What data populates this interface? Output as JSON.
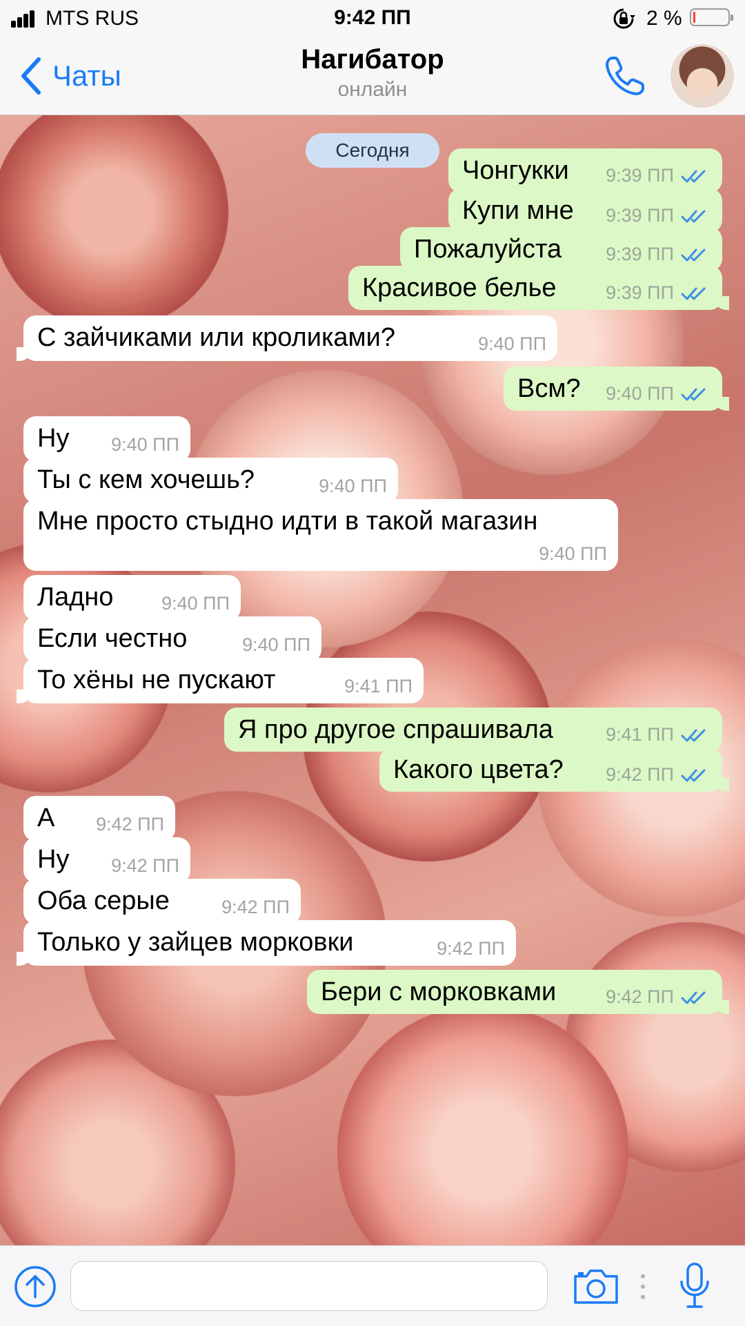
{
  "status_bar": {
    "carrier": "MTS RUS",
    "time": "9:42 ПП",
    "battery_percent": "2 %",
    "icons": [
      "signal-icon",
      "lock-rotation-icon",
      "battery-low-icon"
    ],
    "battery_level": 0.02
  },
  "header": {
    "back_label": "Чаты",
    "title": "Нагибатор",
    "subtitle": "онлайн",
    "icons": [
      "chevron-left-icon",
      "phone-icon",
      "avatar"
    ]
  },
  "date_separator": "Сегодня",
  "messages": [
    {
      "dir": "out",
      "text": "Чонгукки",
      "time": "9:39 ПП",
      "read": true
    },
    {
      "dir": "out",
      "text": "Купи мне",
      "time": "9:39 ПП",
      "read": true
    },
    {
      "dir": "out",
      "text": "Пожалуйста",
      "time": "9:39 ПП",
      "read": true
    },
    {
      "dir": "out",
      "text": "Красивое белье",
      "time": "9:39 ПП",
      "read": true
    },
    {
      "dir": "in",
      "text": "С зайчиками или кроликами?",
      "time": "9:40 ПП"
    },
    {
      "dir": "out",
      "text": "Всм?",
      "time": "9:40 ПП",
      "read": true
    },
    {
      "dir": "in",
      "text": "Ну",
      "time": "9:40 ПП"
    },
    {
      "dir": "in",
      "text": "Ты с кем хочешь?",
      "time": "9:40 ПП"
    },
    {
      "dir": "in",
      "text": "Мне просто стыдно идти в такой магазин",
      "time": "9:40 ПП"
    },
    {
      "dir": "in",
      "text": "Ладно",
      "time": "9:40 ПП"
    },
    {
      "dir": "in",
      "text": "Если честно",
      "time": "9:40 ПП"
    },
    {
      "dir": "in",
      "text": "То хёны не пускают",
      "time": "9:41 ПП"
    },
    {
      "dir": "out",
      "text": "Я про другое спрашивала",
      "time": "9:41 ПП",
      "read": true
    },
    {
      "dir": "out",
      "text": "Какого цвета?",
      "time": "9:42 ПП",
      "read": true
    },
    {
      "dir": "in",
      "text": "А",
      "time": "9:42 ПП"
    },
    {
      "dir": "in",
      "text": "Ну",
      "time": "9:42 ПП"
    },
    {
      "dir": "in",
      "text": "Оба серые",
      "time": "9:42 ПП"
    },
    {
      "dir": "in",
      "text": "Только у зайцев морковки",
      "time": "9:42 ПП"
    },
    {
      "dir": "out",
      "text": "Бери с морковками",
      "time": "9:42 ПП",
      "read": true
    }
  ],
  "input_bar": {
    "placeholder": "",
    "value": "",
    "icons": [
      "attach-arrow-icon",
      "camera-icon",
      "mic-icon"
    ]
  },
  "colors": {
    "accent": "#1a7cf5",
    "outgoing_bubble": "#dcf8c6",
    "incoming_bubble": "#ffffff",
    "read_ticks": "#3d8ee8",
    "date_pill": "#cfe0f5"
  }
}
